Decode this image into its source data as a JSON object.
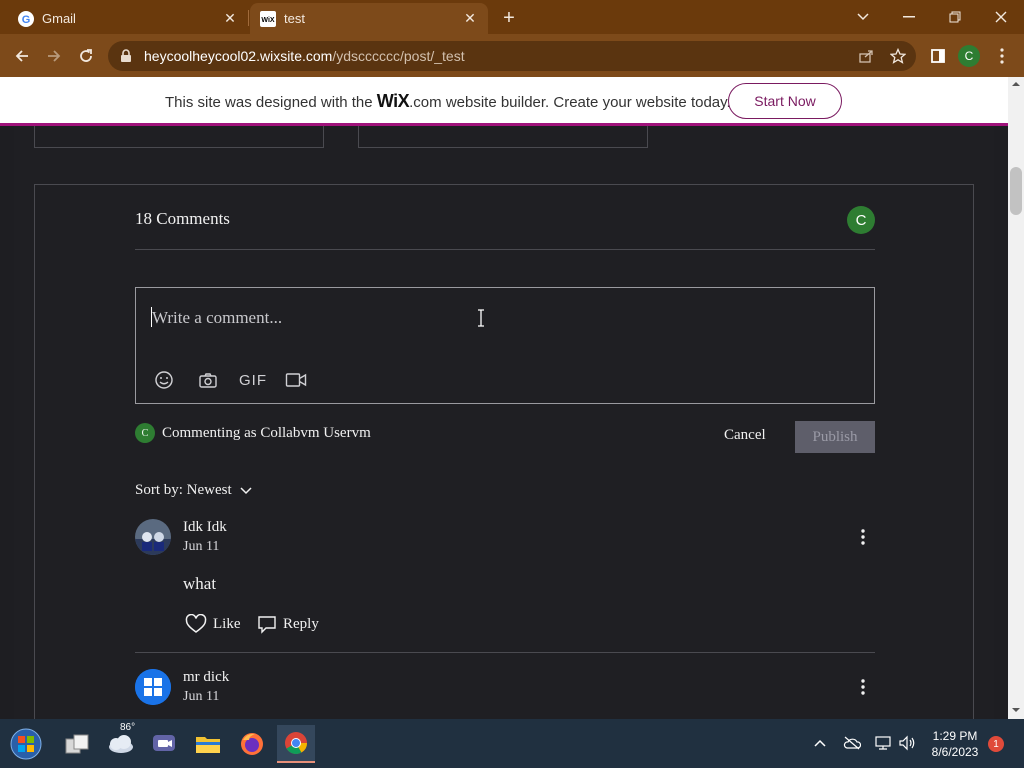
{
  "browser": {
    "tabs": [
      {
        "title": "Gmail",
        "favicon": "google-g-icon"
      },
      {
        "title": "test",
        "favicon": "wix-icon"
      }
    ],
    "url_host": "heycoolheycool02.wixsite.com",
    "url_path": "/ydscccccc/post/_test",
    "profile_initial": "C"
  },
  "banner": {
    "text_before": "This site was designed with the",
    "brand": "WiX",
    "brand_suffix": ".com",
    "text_after": "website builder. Create your website today.",
    "cta": "Start Now"
  },
  "comments": {
    "count_label": "18 Comments",
    "user_initial": "C",
    "editor_placeholder": "Write a comment...",
    "toolbar_icons": [
      "smiley-icon",
      "camera-icon",
      "gif-icon",
      "video-icon"
    ],
    "gif_label": "GIF",
    "commenting_as": "Commenting as Collabvm Uservm",
    "cancel_label": "Cancel",
    "publish_label": "Publish",
    "sort_label": "Sort by: Newest",
    "items": [
      {
        "author": "Idk Idk",
        "date": "Jun 11",
        "body": "what",
        "like_label": "Like",
        "reply_label": "Reply"
      },
      {
        "author": "mr dick",
        "date": "Jun 11"
      }
    ]
  },
  "taskbar": {
    "weather_temp": "86°",
    "time": "1:29 PM",
    "date": "8/6/2023",
    "notification_count": "1"
  },
  "colors": {
    "tab_bar": "#6b3a0c",
    "toolbar": "#7d4a1a",
    "page_bg": "#1f1f23",
    "accent_green": "#2e7d32",
    "wix_magenta": "#a0137b"
  }
}
